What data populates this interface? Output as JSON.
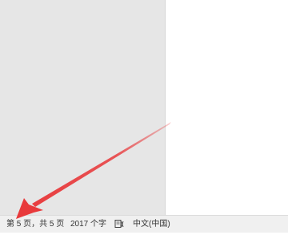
{
  "status_bar": {
    "page_count": "第 5 页，共 5 页",
    "word_count": "2017 个字",
    "proofing_icon": "proofing-icon",
    "language": "中文(中国)"
  },
  "colors": {
    "gray_panel": "#e6e6e6",
    "arrow": "#e8393b"
  }
}
